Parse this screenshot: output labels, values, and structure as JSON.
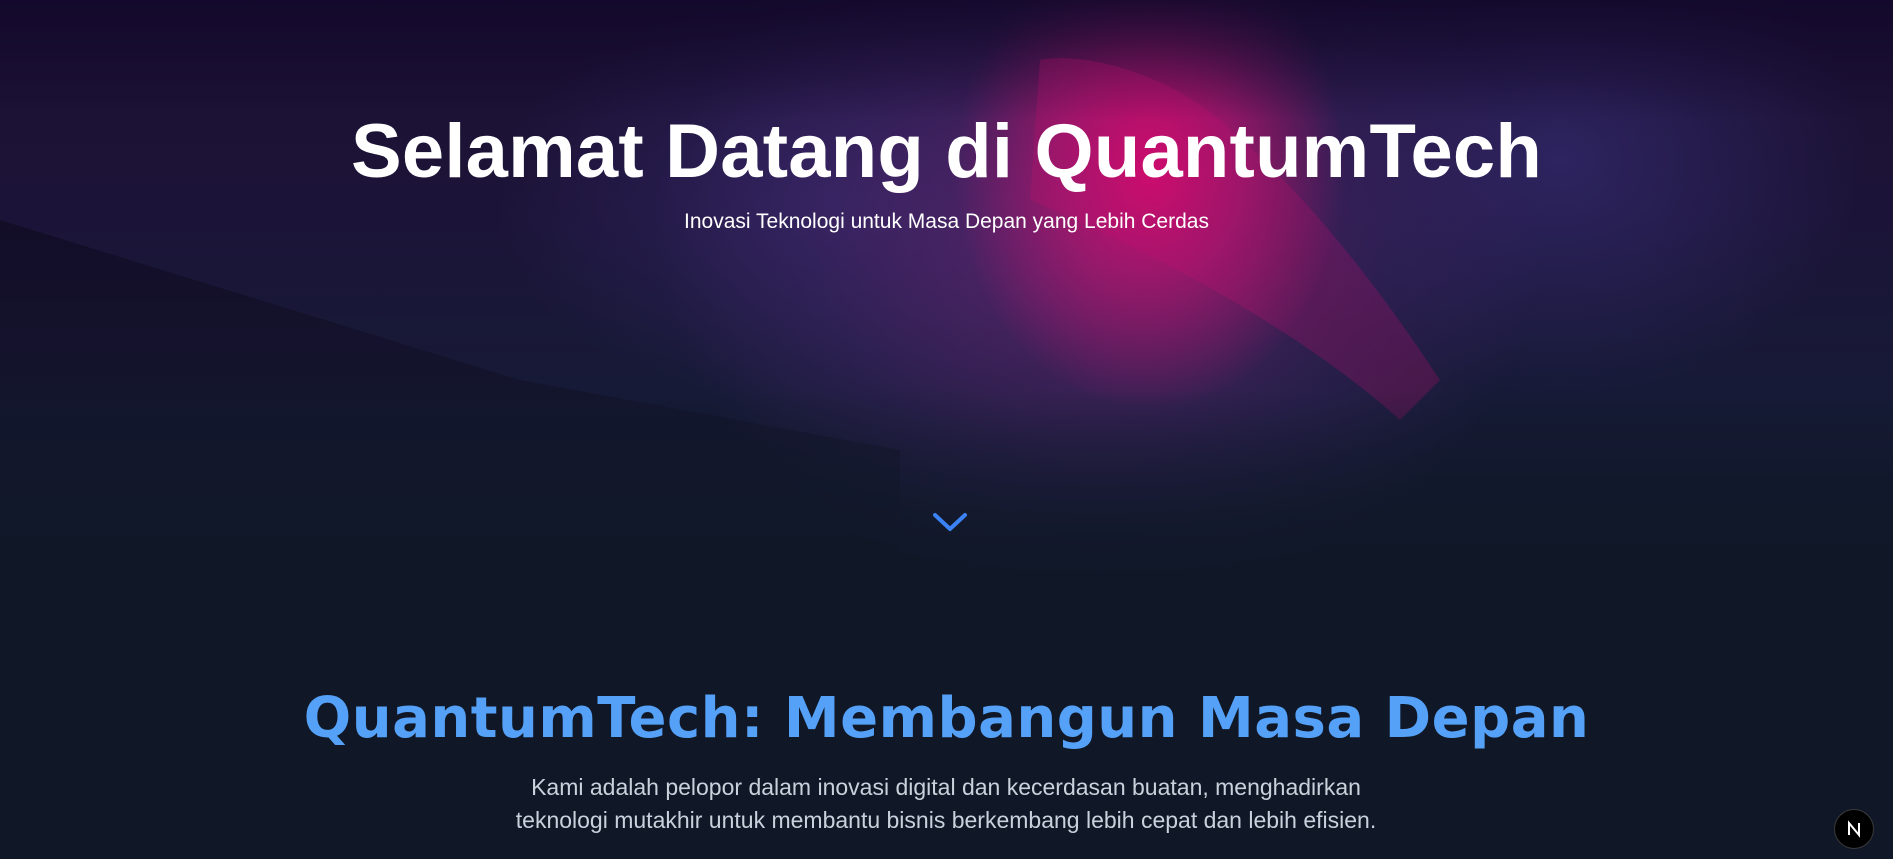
{
  "hero": {
    "title": "Selamat Datang di QuantumTech",
    "subtitle": "Inovasi Teknologi untuk Masa Depan yang Lebih Cerdas",
    "scroll_icon": "chevron-down-icon"
  },
  "about": {
    "title": "QuantumTech: Membangun Masa Depan",
    "text": "Kami adalah pelopor dalam inovasi digital dan kecerdasan buatan, menghadirkan teknologi mutakhir untuk membantu bisnis berkembang lebih cepat dan lebih efisien."
  },
  "dev_badge": {
    "letter": "N",
    "icon": "nextjs-logo-icon"
  },
  "colors": {
    "background": "#101828",
    "accent": "#55a1f8",
    "hero_glow": "#d70a6e",
    "chevron": "#3b82f6"
  }
}
